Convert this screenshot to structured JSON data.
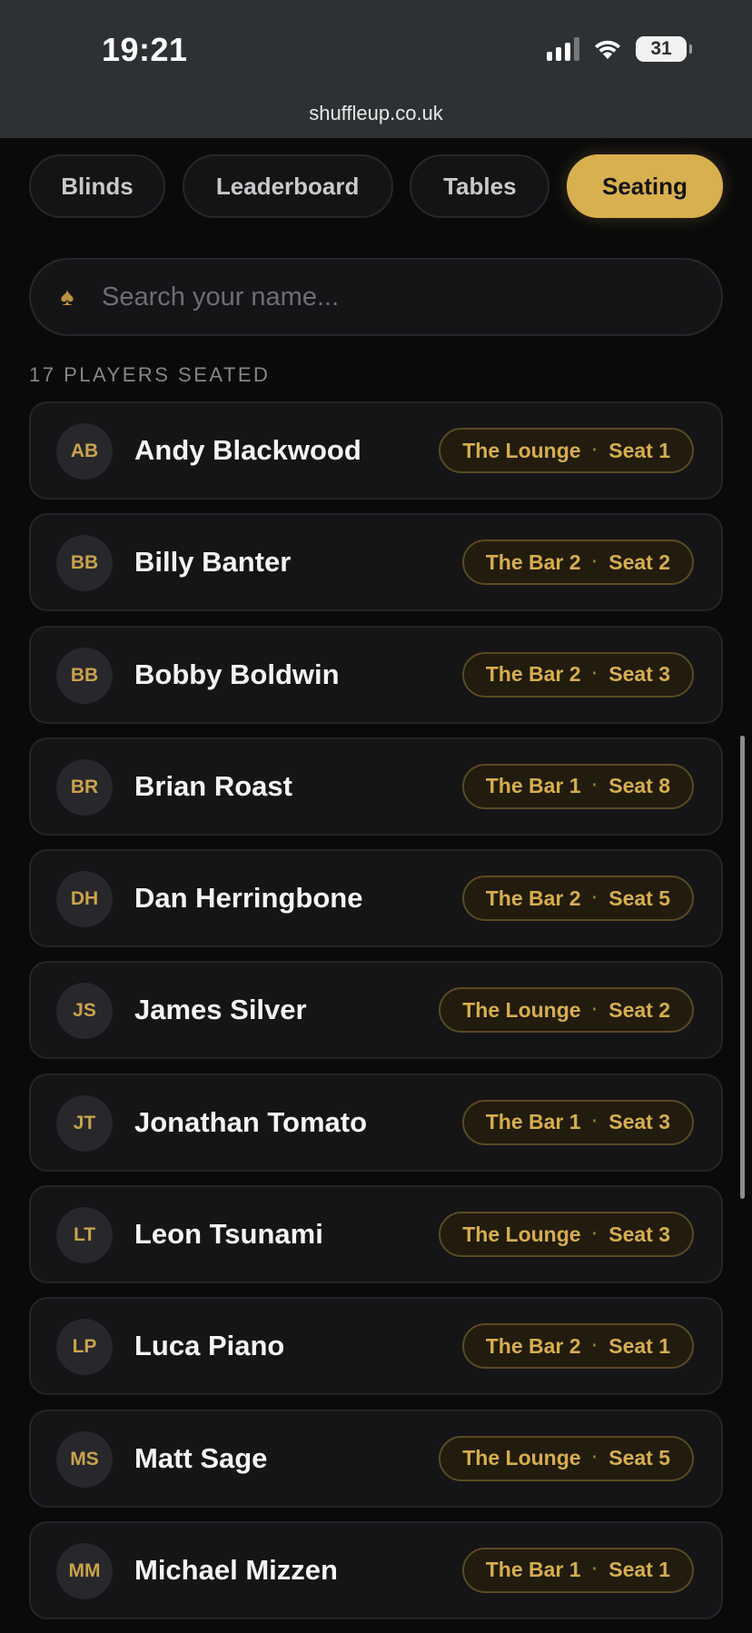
{
  "status_bar": {
    "time": "19:21",
    "battery": "31",
    "url": "shuffleup.co.uk"
  },
  "tabs": [
    {
      "label": "Blinds",
      "active": false
    },
    {
      "label": "Leaderboard",
      "active": false
    },
    {
      "label": "Tables",
      "active": false
    },
    {
      "label": "Seating",
      "active": true
    }
  ],
  "search": {
    "placeholder": "Search your name...",
    "value": "",
    "icon": "spade-icon"
  },
  "players_count": "17 PLAYERS SEATED",
  "players": [
    {
      "initials": "AB",
      "name": "Andy Blackwood",
      "table": "The Lounge",
      "seat": "Seat 1"
    },
    {
      "initials": "BB",
      "name": "Billy Banter",
      "table": "The Bar 2",
      "seat": "Seat 2"
    },
    {
      "initials": "BB",
      "name": "Bobby Boldwin",
      "table": "The Bar 2",
      "seat": "Seat 3"
    },
    {
      "initials": "BR",
      "name": "Brian Roast",
      "table": "The Bar 1",
      "seat": "Seat 8"
    },
    {
      "initials": "DH",
      "name": "Dan Herringbone",
      "table": "The Bar 2",
      "seat": "Seat 5"
    },
    {
      "initials": "JS",
      "name": "James Silver",
      "table": "The Lounge",
      "seat": "Seat 2"
    },
    {
      "initials": "JT",
      "name": "Jonathan Tomato",
      "table": "The Bar 1",
      "seat": "Seat 3"
    },
    {
      "initials": "LT",
      "name": "Leon Tsunami",
      "table": "The Lounge",
      "seat": "Seat 3"
    },
    {
      "initials": "LP",
      "name": "Luca Piano",
      "table": "The Bar 2",
      "seat": "Seat 1"
    },
    {
      "initials": "MS",
      "name": "Matt Sage",
      "table": "The Lounge",
      "seat": "Seat 5"
    },
    {
      "initials": "MM",
      "name": "Michael Mizzen",
      "table": "The Bar 1",
      "seat": "Seat 1"
    }
  ],
  "separator": "·",
  "colors": {
    "accent": "#d9b04f",
    "background": "#0a0a0b",
    "card": "#151517",
    "pill_background": "#211c0e"
  }
}
